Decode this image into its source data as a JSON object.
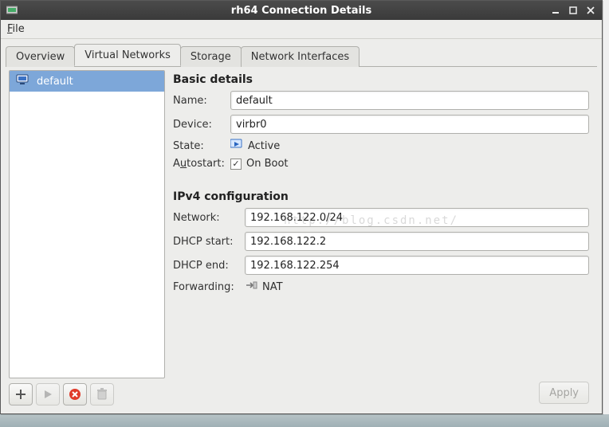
{
  "window": {
    "title": "rh64 Connection Details",
    "app_icon": "vm-icon"
  },
  "menubar": {
    "file": "File"
  },
  "tabs": {
    "overview": "Overview",
    "virtual_networks": "Virtual Networks",
    "storage": "Storage",
    "network_interfaces": "Network Interfaces",
    "active": "virtual_networks"
  },
  "network_list": {
    "items": [
      {
        "label": "default",
        "selected": true
      }
    ]
  },
  "toolbar": {
    "add_tip": "Add Network",
    "start_tip": "Start Network",
    "stop_tip": "Stop Network",
    "delete_tip": "Delete Network"
  },
  "basic_details": {
    "heading": "Basic details",
    "name_label": "Name:",
    "name_value": "default",
    "device_label": "Device:",
    "device_value": "virbr0",
    "state_label": "State:",
    "state_value": "Active",
    "autostart_label": "Autostart:",
    "autostart_checked": true,
    "autostart_text": "On Boot"
  },
  "ipv4": {
    "heading": "IPv4 configuration",
    "network_label": "Network:",
    "network_value": "192.168.122.0/24",
    "dhcp_start_label": "DHCP start:",
    "dhcp_start_value": "192.168.122.2",
    "dhcp_end_label": "DHCP end:",
    "dhcp_end_value": "192.168.122.254",
    "forwarding_label": "Forwarding:",
    "forwarding_value": "NAT"
  },
  "apply": {
    "label": "Apply"
  },
  "watermark": "http://blog.csdn.net/"
}
